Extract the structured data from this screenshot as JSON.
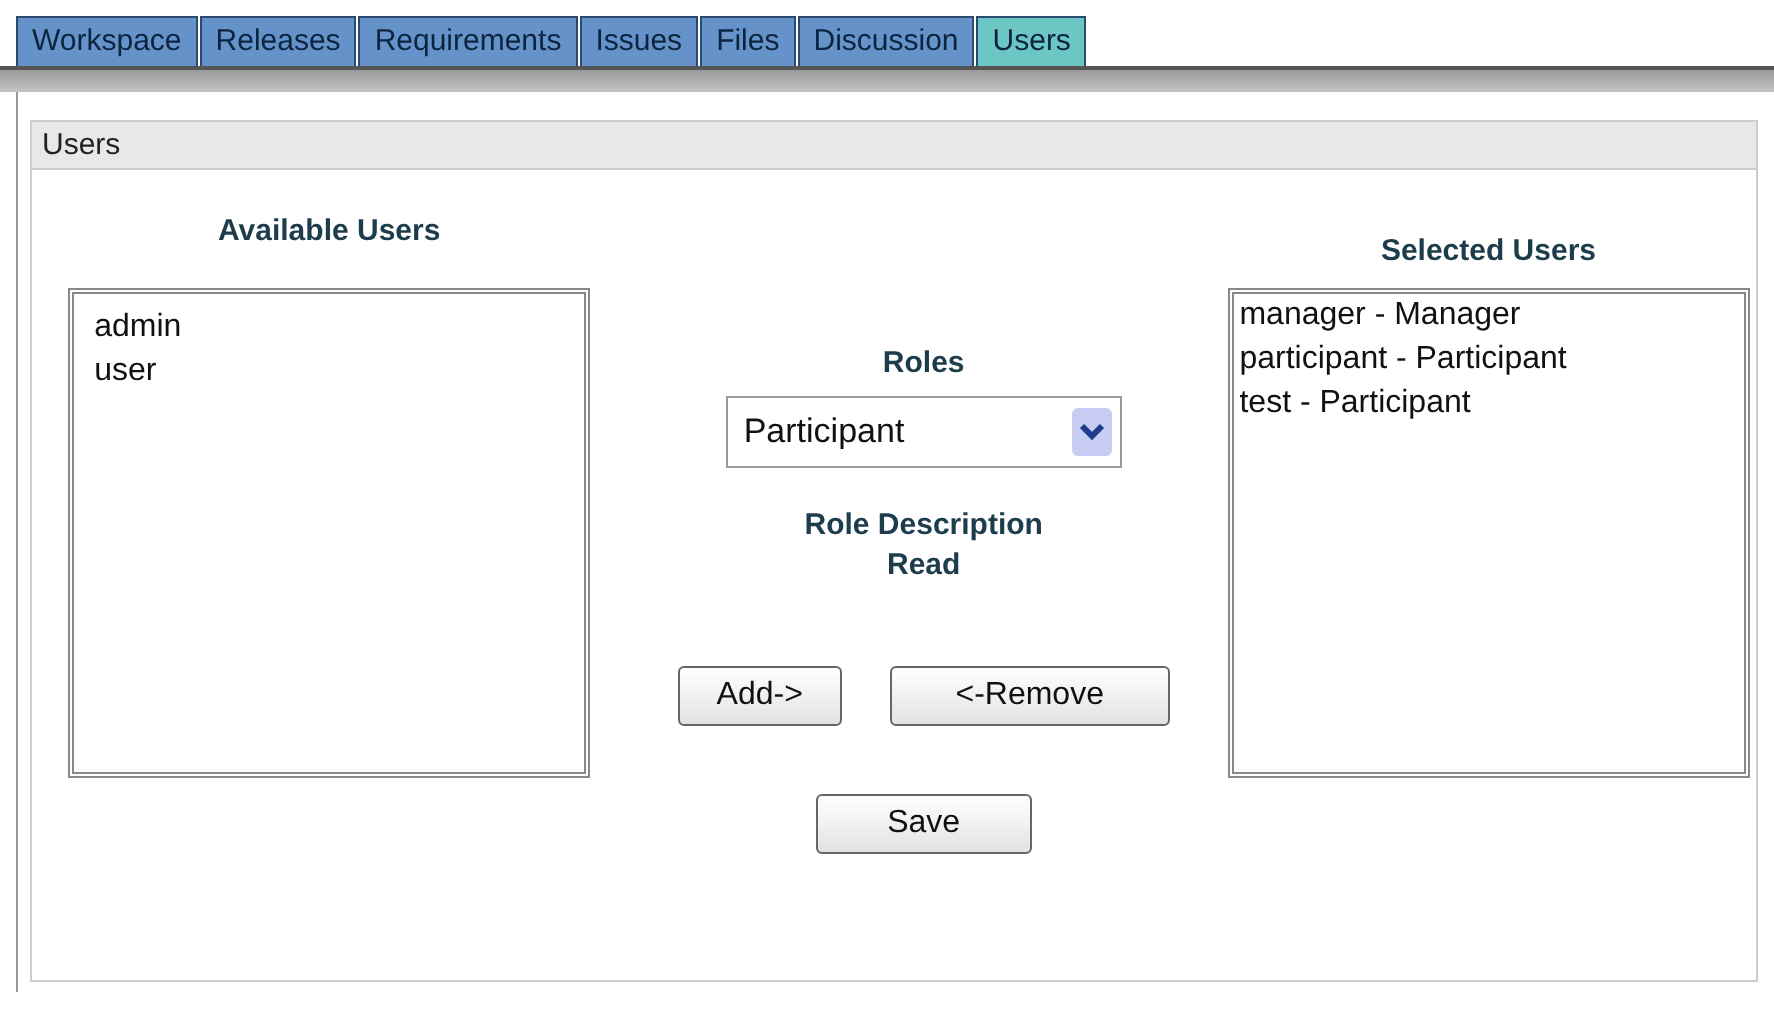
{
  "tabs": [
    {
      "label": "Workspace",
      "selected": false
    },
    {
      "label": "Releases",
      "selected": false
    },
    {
      "label": "Requirements",
      "selected": false
    },
    {
      "label": "Issues",
      "selected": false
    },
    {
      "label": "Files",
      "selected": false
    },
    {
      "label": "Discussion",
      "selected": false
    },
    {
      "label": "Users",
      "selected": true
    }
  ],
  "section_title": "Users",
  "available_users": {
    "heading": "Available Users",
    "items": [
      "admin",
      "user"
    ]
  },
  "roles": {
    "label": "Roles",
    "value": "Participant"
  },
  "role_description": {
    "label": "Role Description",
    "value": "Read"
  },
  "buttons": {
    "add": "Add->",
    "remove": "<-Remove",
    "save": "Save"
  },
  "selected_users": {
    "heading": "Selected Users",
    "items": [
      "manager - Manager",
      "participant - Participant",
      "test - Participant"
    ]
  }
}
